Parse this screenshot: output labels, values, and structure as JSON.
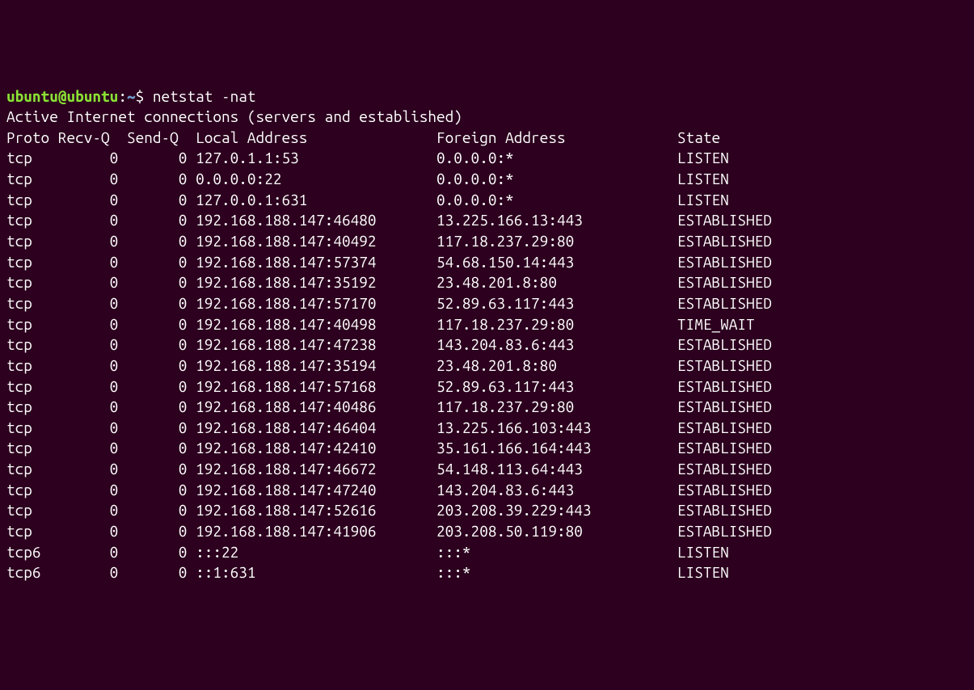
{
  "prompt": {
    "user": "ubuntu",
    "host": "ubuntu",
    "path": "~",
    "command": "netstat -nat"
  },
  "header": "Active Internet connections (servers and established)",
  "columns": {
    "proto": "Proto",
    "recvq": "Recv-Q",
    "sendq": "Send-Q",
    "local": "Local Address",
    "foreign": "Foreign Address",
    "state": "State"
  },
  "rows": [
    {
      "proto": "tcp",
      "recvq": "0",
      "sendq": "0",
      "local": "127.0.1.1:53",
      "foreign": "0.0.0.0:*",
      "state": "LISTEN"
    },
    {
      "proto": "tcp",
      "recvq": "0",
      "sendq": "0",
      "local": "0.0.0.0:22",
      "foreign": "0.0.0.0:*",
      "state": "LISTEN"
    },
    {
      "proto": "tcp",
      "recvq": "0",
      "sendq": "0",
      "local": "127.0.0.1:631",
      "foreign": "0.0.0.0:*",
      "state": "LISTEN"
    },
    {
      "proto": "tcp",
      "recvq": "0",
      "sendq": "0",
      "local": "192.168.188.147:46480",
      "foreign": "13.225.166.13:443",
      "state": "ESTABLISHED"
    },
    {
      "proto": "tcp",
      "recvq": "0",
      "sendq": "0",
      "local": "192.168.188.147:40492",
      "foreign": "117.18.237.29:80",
      "state": "ESTABLISHED"
    },
    {
      "proto": "tcp",
      "recvq": "0",
      "sendq": "0",
      "local": "192.168.188.147:57374",
      "foreign": "54.68.150.14:443",
      "state": "ESTABLISHED"
    },
    {
      "proto": "tcp",
      "recvq": "0",
      "sendq": "0",
      "local": "192.168.188.147:35192",
      "foreign": "23.48.201.8:80",
      "state": "ESTABLISHED"
    },
    {
      "proto": "tcp",
      "recvq": "0",
      "sendq": "0",
      "local": "192.168.188.147:57170",
      "foreign": "52.89.63.117:443",
      "state": "ESTABLISHED"
    },
    {
      "proto": "tcp",
      "recvq": "0",
      "sendq": "0",
      "local": "192.168.188.147:40498",
      "foreign": "117.18.237.29:80",
      "state": "TIME_WAIT"
    },
    {
      "proto": "tcp",
      "recvq": "0",
      "sendq": "0",
      "local": "192.168.188.147:47238",
      "foreign": "143.204.83.6:443",
      "state": "ESTABLISHED"
    },
    {
      "proto": "tcp",
      "recvq": "0",
      "sendq": "0",
      "local": "192.168.188.147:35194",
      "foreign": "23.48.201.8:80",
      "state": "ESTABLISHED"
    },
    {
      "proto": "tcp",
      "recvq": "0",
      "sendq": "0",
      "local": "192.168.188.147:57168",
      "foreign": "52.89.63.117:443",
      "state": "ESTABLISHED"
    },
    {
      "proto": "tcp",
      "recvq": "0",
      "sendq": "0",
      "local": "192.168.188.147:40486",
      "foreign": "117.18.237.29:80",
      "state": "ESTABLISHED"
    },
    {
      "proto": "tcp",
      "recvq": "0",
      "sendq": "0",
      "local": "192.168.188.147:46404",
      "foreign": "13.225.166.103:443",
      "state": "ESTABLISHED"
    },
    {
      "proto": "tcp",
      "recvq": "0",
      "sendq": "0",
      "local": "192.168.188.147:42410",
      "foreign": "35.161.166.164:443",
      "state": "ESTABLISHED"
    },
    {
      "proto": "tcp",
      "recvq": "0",
      "sendq": "0",
      "local": "192.168.188.147:46672",
      "foreign": "54.148.113.64:443",
      "state": "ESTABLISHED"
    },
    {
      "proto": "tcp",
      "recvq": "0",
      "sendq": "0",
      "local": "192.168.188.147:47240",
      "foreign": "143.204.83.6:443",
      "state": "ESTABLISHED"
    },
    {
      "proto": "tcp",
      "recvq": "0",
      "sendq": "0",
      "local": "192.168.188.147:52616",
      "foreign": "203.208.39.229:443",
      "state": "ESTABLISHED"
    },
    {
      "proto": "tcp",
      "recvq": "0",
      "sendq": "0",
      "local": "192.168.188.147:41906",
      "foreign": "203.208.50.119:80",
      "state": "ESTABLISHED"
    },
    {
      "proto": "tcp6",
      "recvq": "0",
      "sendq": "0",
      "local": ":::22",
      "foreign": ":::*",
      "state": "LISTEN"
    },
    {
      "proto": "tcp6",
      "recvq": "0",
      "sendq": "0",
      "local": "::1:631",
      "foreign": ":::*",
      "state": "LISTEN"
    }
  ]
}
